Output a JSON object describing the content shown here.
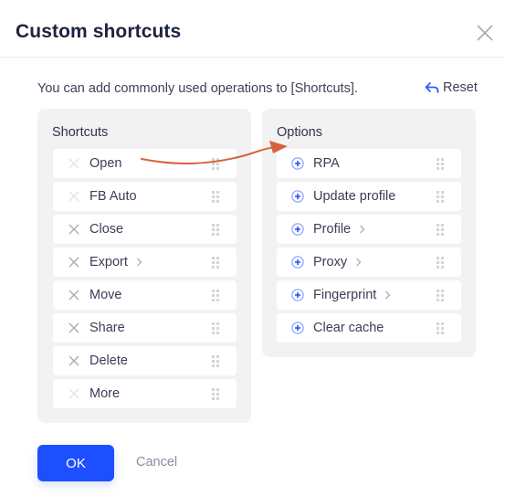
{
  "dialog": {
    "title": "Custom shortcuts",
    "description": "You can add commonly used operations to [Shortcuts].",
    "reset_label": "Reset",
    "ok_label": "OK",
    "cancel_label": "Cancel"
  },
  "shortcuts": {
    "title": "Shortcuts",
    "items": [
      {
        "label": "Open",
        "removable": false,
        "has_submenu": false
      },
      {
        "label": "FB Auto",
        "removable": false,
        "has_submenu": false
      },
      {
        "label": "Close",
        "removable": true,
        "has_submenu": false
      },
      {
        "label": "Export",
        "removable": true,
        "has_submenu": true
      },
      {
        "label": "Move",
        "removable": true,
        "has_submenu": false
      },
      {
        "label": "Share",
        "removable": true,
        "has_submenu": false
      },
      {
        "label": "Delete",
        "removable": true,
        "has_submenu": false
      },
      {
        "label": "More",
        "removable": false,
        "has_submenu": false
      }
    ]
  },
  "options": {
    "title": "Options",
    "items": [
      {
        "label": "RPA",
        "has_submenu": false
      },
      {
        "label": "Update profile",
        "has_submenu": false
      },
      {
        "label": "Profile",
        "has_submenu": true
      },
      {
        "label": "Proxy",
        "has_submenu": true
      },
      {
        "label": "Fingerprint",
        "has_submenu": true
      },
      {
        "label": "Clear cache",
        "has_submenu": false
      }
    ]
  },
  "colors": {
    "accent": "#1e4fff",
    "annotation_arrow": "#d9623c",
    "panel_bg": "#f2f2f3"
  }
}
